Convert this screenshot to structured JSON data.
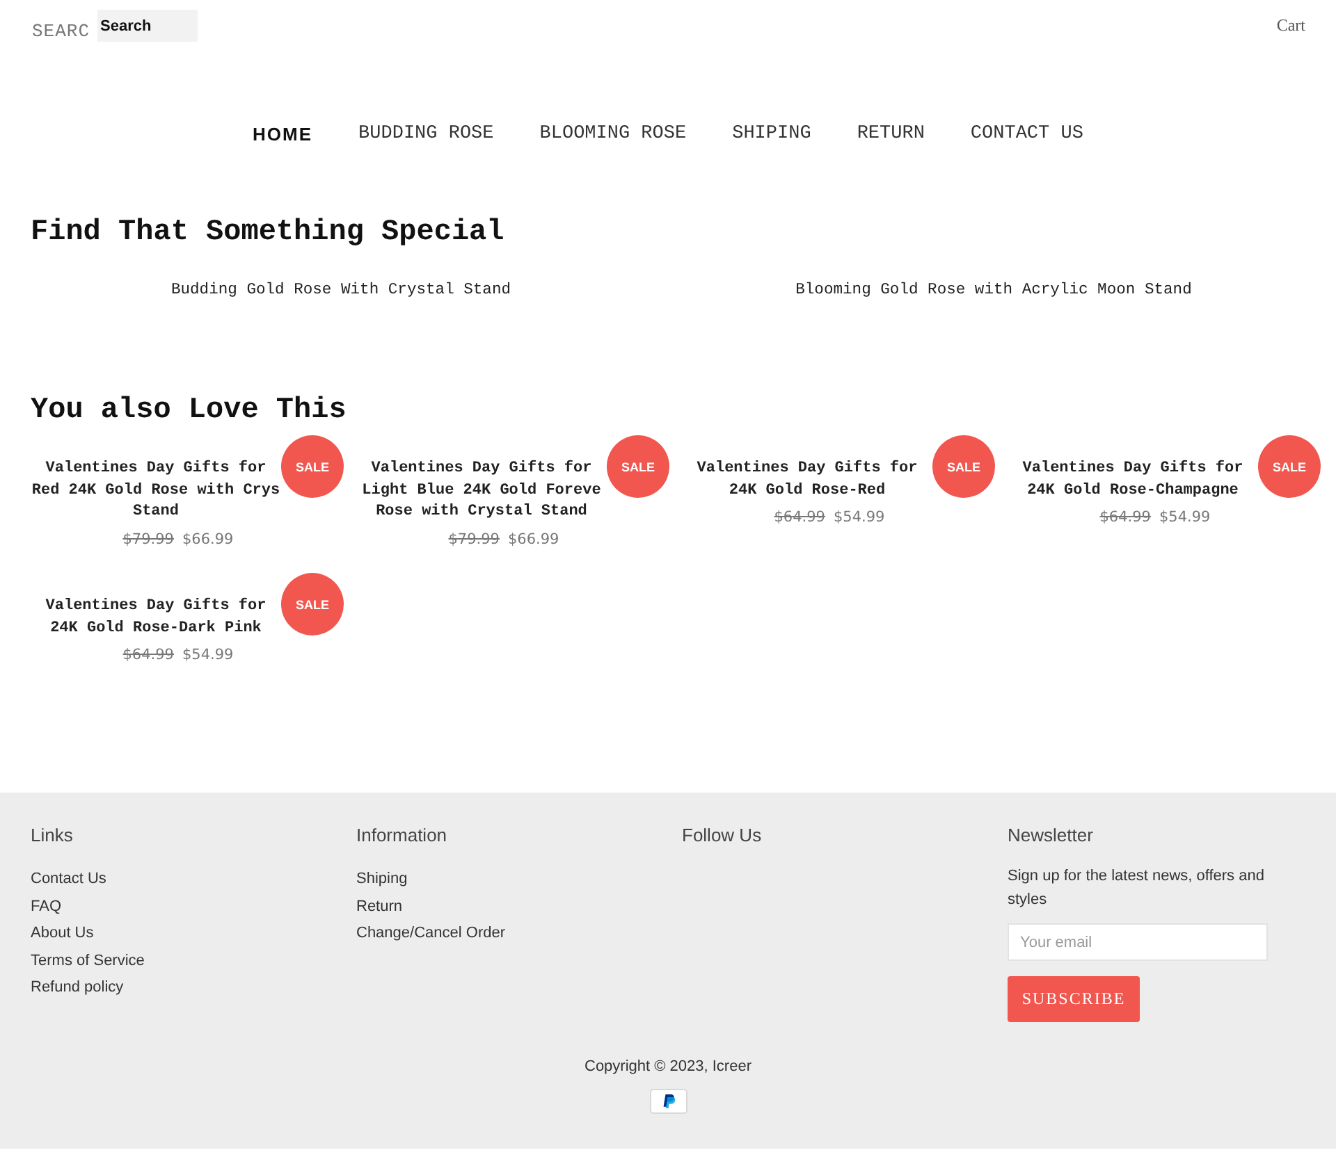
{
  "header": {
    "search": {
      "label": "SEARC",
      "placeholder": "Search"
    },
    "cart": "Cart"
  },
  "nav": [
    {
      "label": "HOME",
      "selected": true
    },
    {
      "label": "BUDDING ROSE",
      "selected": false
    },
    {
      "label": "BLOOMING ROSE",
      "selected": false
    },
    {
      "label": "SHIPING",
      "selected": false
    },
    {
      "label": "RETURN",
      "selected": false
    },
    {
      "label": "CONTACT US",
      "selected": false
    }
  ],
  "featured": {
    "heading": "Find That Something Special",
    "collections": [
      "Budding Gold Rose With Crystal Stand",
      "Blooming Gold Rose with Acrylic Moon Stand"
    ]
  },
  "related": {
    "heading": "You also Love This",
    "products": [
      {
        "title_lines": [
          "Valentines Day Gifts for",
          "Red 24K Gold Rose with Crys",
          "Stand"
        ],
        "compare_price": "$79.99",
        "price": "$66.99",
        "badge": "SALE"
      },
      {
        "title_lines": [
          "Valentines Day Gifts for",
          "Light Blue 24K Gold Foreve",
          "Rose with Crystal Stand"
        ],
        "compare_price": "$79.99",
        "price": "$66.99",
        "badge": "SALE"
      },
      {
        "title_lines": [
          "Valentines Day Gifts for",
          "24K Gold Rose-Red"
        ],
        "compare_price": "$64.99",
        "price": "$54.99",
        "badge": "SALE"
      },
      {
        "title_lines": [
          "Valentines Day Gifts for",
          "24K Gold Rose-Champagne"
        ],
        "compare_price": "$64.99",
        "price": "$54.99",
        "badge": "SALE"
      },
      {
        "title_lines": [
          "Valentines Day Gifts for",
          "24K Gold Rose-Dark Pink"
        ],
        "compare_price": "$64.99",
        "price": "$54.99",
        "badge": "SALE"
      }
    ]
  },
  "footer": {
    "columns": [
      {
        "kind": "links",
        "heading": "Links",
        "items": [
          "Contact Us",
          "FAQ",
          "About Us",
          "Terms of Service",
          "Refund policy"
        ]
      },
      {
        "kind": "links",
        "heading": "Information",
        "items": [
          "Shiping",
          "Return",
          "Change/Cancel Order"
        ]
      },
      {
        "kind": "links",
        "heading": "Follow Us"
      },
      {
        "kind": "newsletter",
        "heading": "Newsletter",
        "text": "Sign up for the latest news, offers and styles",
        "placeholder": "Your email",
        "button": "SUBSCRIBE"
      }
    ],
    "copyright": "Copyright © 2023, Icreer"
  }
}
